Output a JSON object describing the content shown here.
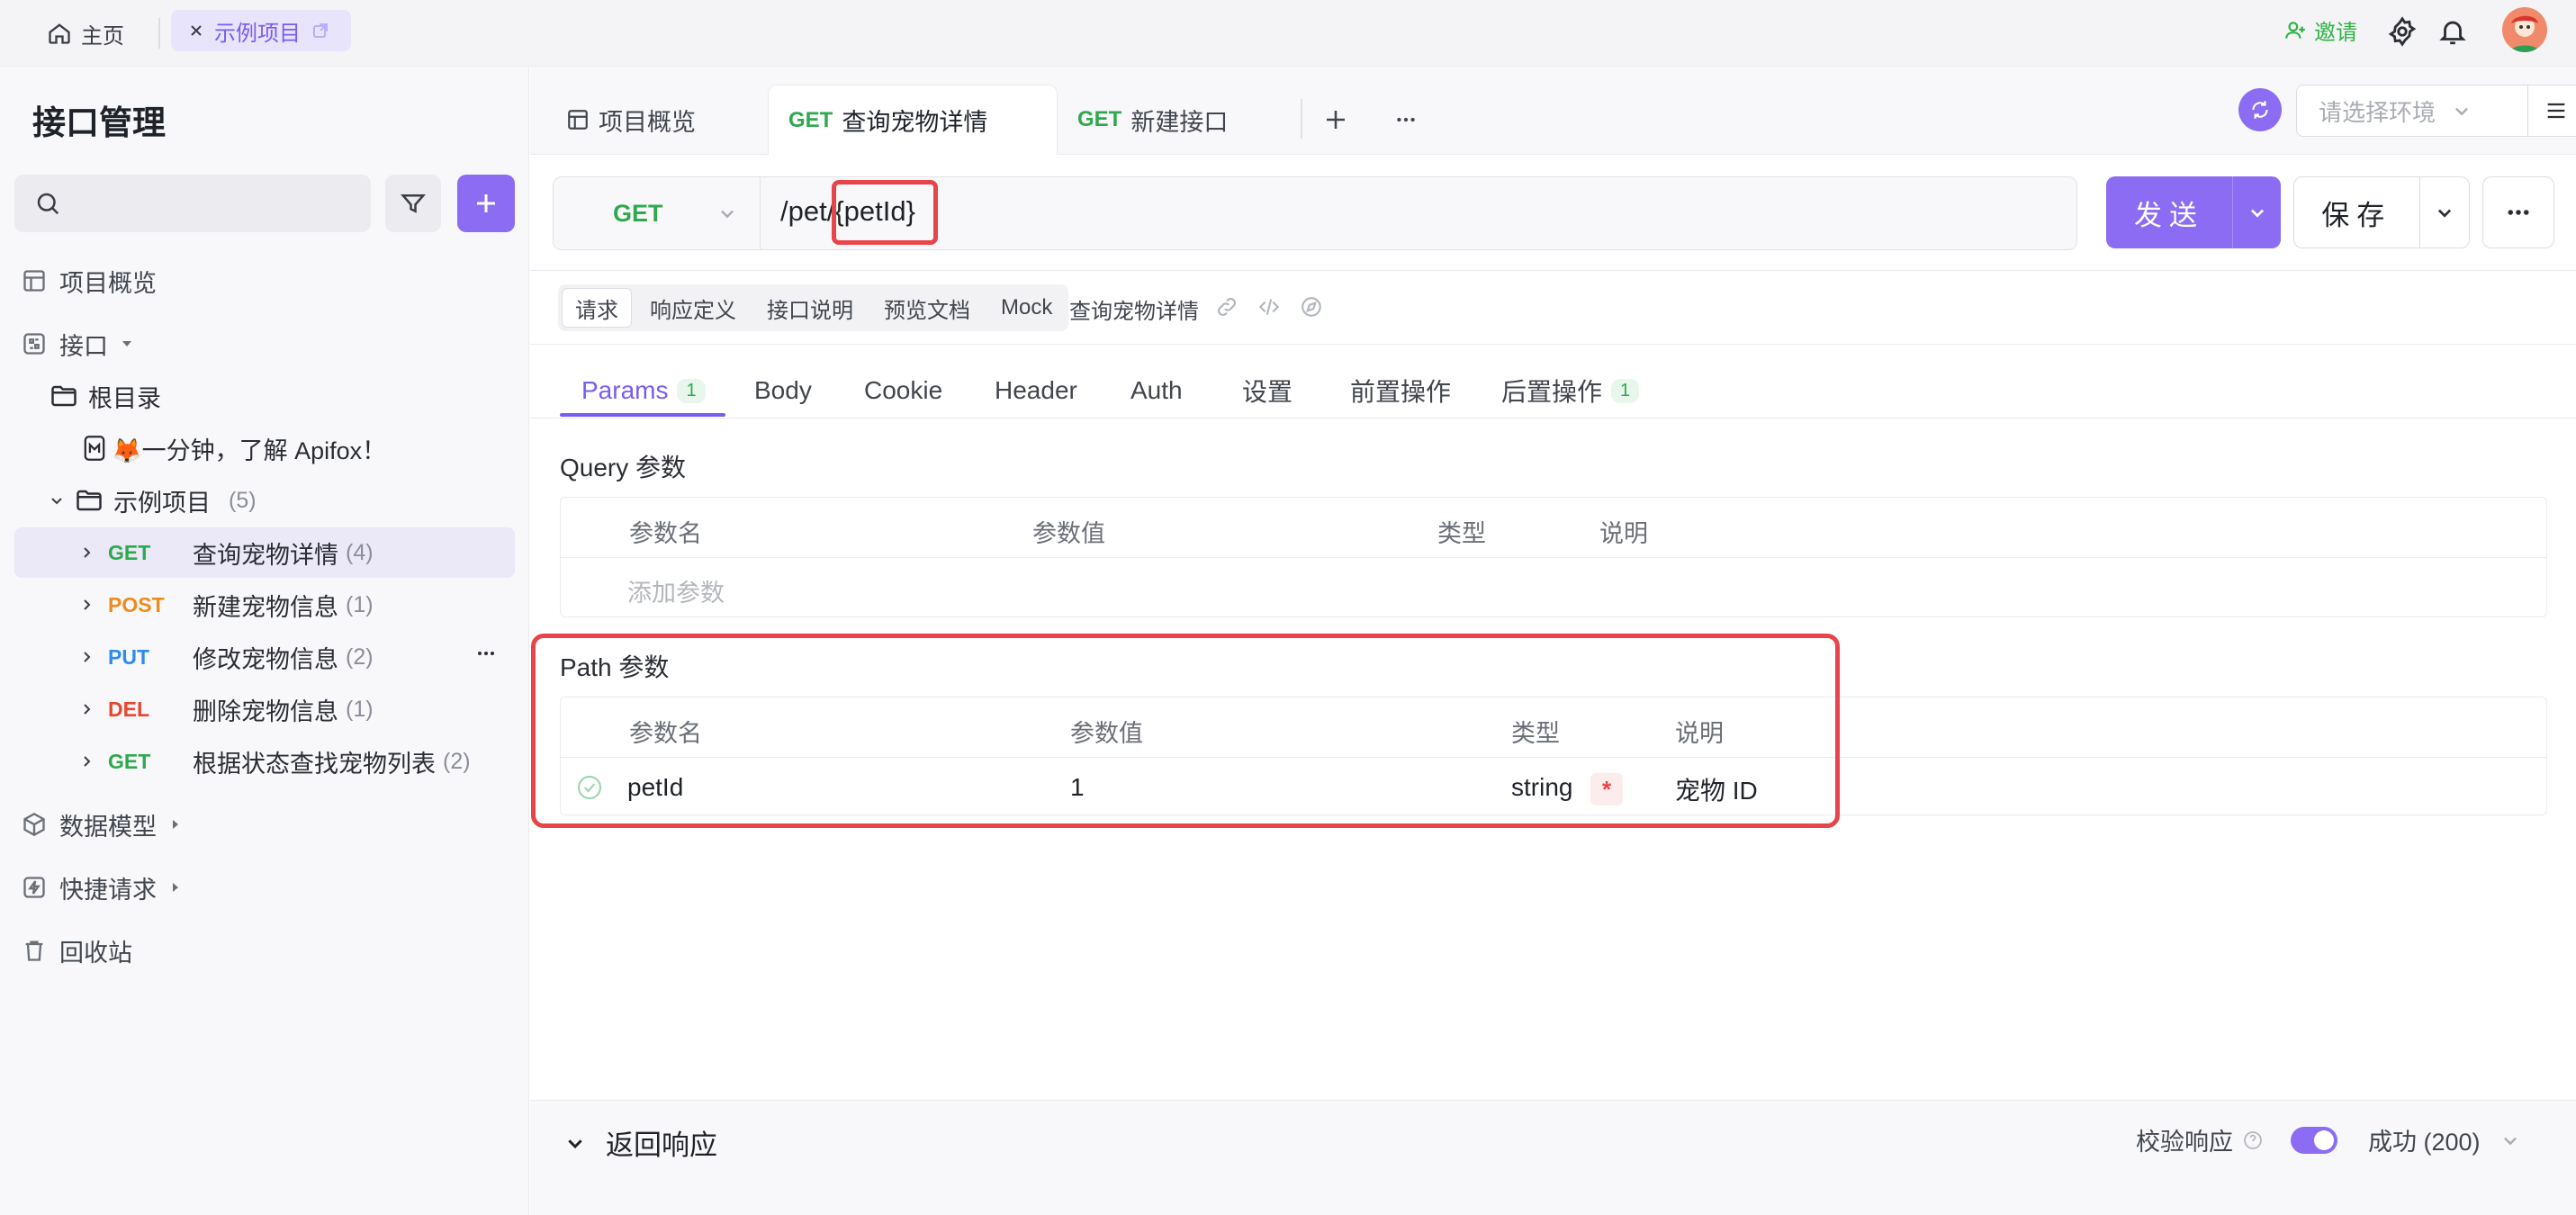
{
  "topbar": {
    "home_label": "主页",
    "project_tab_label": "示例项目",
    "invite_label": "邀请"
  },
  "sidebar": {
    "title": "接口管理",
    "search_placeholder": "",
    "nav": {
      "overview": "项目概览",
      "apis": "接口",
      "data_models": "数据模型",
      "quick_requests": "快捷请求",
      "trash": "回收站"
    },
    "tree": {
      "root": "根目录",
      "intro_doc": "🦊一分钟，了解 Apifox！",
      "folder": "示例项目",
      "folder_count": "(5)",
      "endpoints": [
        {
          "method": "GET",
          "name": "查询宠物详情",
          "count": "(4)"
        },
        {
          "method": "POST",
          "name": "新建宠物信息",
          "count": "(1)"
        },
        {
          "method": "PUT",
          "name": "修改宠物信息",
          "count": "(2)"
        },
        {
          "method": "DEL",
          "name": "删除宠物信息",
          "count": "(1)"
        },
        {
          "method": "GET",
          "name": "根据状态查找宠物列表",
          "count": "(2)"
        }
      ]
    }
  },
  "tabs": {
    "overview": "项目概览",
    "active_method": "GET",
    "active_name": "查询宠物详情",
    "new_method": "GET",
    "new_name": "新建接口",
    "env_placeholder": "请选择环境"
  },
  "request": {
    "method": "GET",
    "url_prefix": "/pet/",
    "url_param": "{petId}",
    "send_label": "发送",
    "save_label": "保存"
  },
  "subtabs": [
    "请求",
    "响应定义",
    "接口说明",
    "预览文档",
    "Mock"
  ],
  "api_name": "查询宠物详情",
  "param_tabs": [
    {
      "label": "Params",
      "badge": "1"
    },
    {
      "label": "Body",
      "badge": ""
    },
    {
      "label": "Cookie",
      "badge": ""
    },
    {
      "label": "Header",
      "badge": ""
    },
    {
      "label": "Auth",
      "badge": ""
    },
    {
      "label": "设置",
      "badge": ""
    },
    {
      "label": "前置操作",
      "badge": ""
    },
    {
      "label": "后置操作",
      "badge": "1"
    }
  ],
  "query_params": {
    "title": "Query 参数",
    "headers": [
      "参数名",
      "参数值",
      "类型",
      "说明"
    ],
    "add_placeholder": "添加参数"
  },
  "path_params": {
    "title": "Path 参数",
    "headers": [
      "参数名",
      "参数值",
      "类型",
      "说明"
    ],
    "rows": [
      {
        "name": "petId",
        "value": "1",
        "type": "string",
        "required": "*",
        "desc": "宠物 ID"
      }
    ]
  },
  "response": {
    "title": "返回响应",
    "validate_label": "校验响应",
    "validate_on": true,
    "status_label": "成功 (200)"
  },
  "colors": {
    "accent": "#8b6cf2",
    "get": "#2fa84f",
    "post": "#ef8b1c",
    "put": "#2d8cf0",
    "del": "#e8452f",
    "highlight": "#e8454a"
  }
}
